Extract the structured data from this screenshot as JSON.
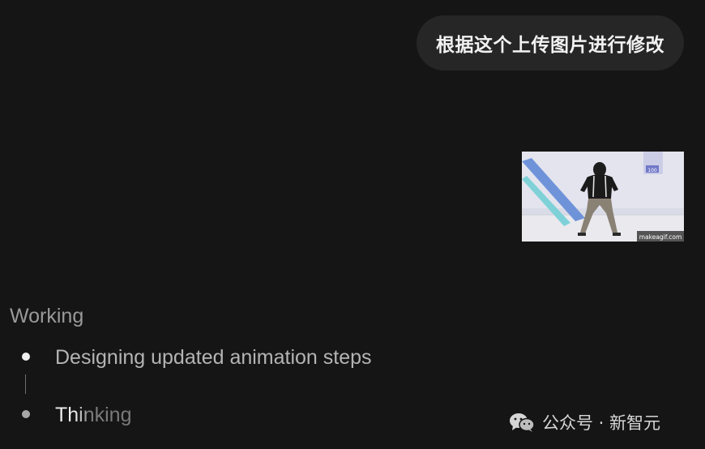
{
  "user_message": {
    "text": "根据这个上传图片进行修改"
  },
  "attachment": {
    "caption": "makeagif.com",
    "badge_text": "100"
  },
  "status": {
    "title": "Working",
    "steps": [
      {
        "label": "Designing updated animation steps",
        "state": "done"
      },
      {
        "label": "Thinking",
        "state": "active"
      }
    ]
  },
  "watermark": {
    "icon": "wechat-icon",
    "text": "公众号 · 新智元"
  },
  "colors": {
    "background": "#151515",
    "bubble": "#262626",
    "text_primary": "#f2f2f2",
    "text_muted": "#9a9a9a",
    "step_text": "#b4b4b4"
  }
}
